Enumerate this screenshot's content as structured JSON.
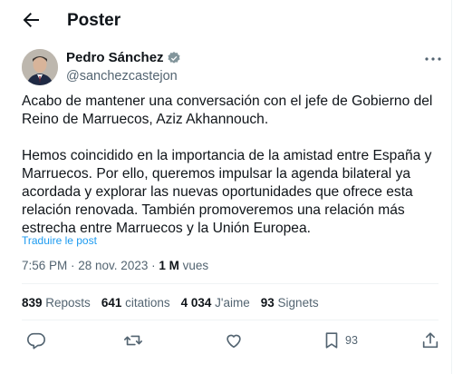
{
  "header": {
    "title": "Poster"
  },
  "author": {
    "name": "Pedro Sánchez",
    "handle": "@sanchezcastejon"
  },
  "tweet": {
    "paragraph1": "Acabo de mantener una conversación con el jefe de Gobierno del Reino de Marruecos, Aziz Akhannouch.",
    "paragraph2": "Hemos coincidido en la importancia de la amistad entre España y Marruecos. Por ello, queremos impulsar la agenda bilateral ya acordada y explorar las nuevas oportunidades que ofrece esta relación renovada. También promoveremos una relación más estrecha entre Marruecos y la Unión Europea.",
    "translate_link": "Traduire le post",
    "timestamp": "7:56 PM · 28 nov. 2023 · ",
    "views_count": "1 M",
    "views_label": " vues"
  },
  "stats": {
    "reposts_count": "839",
    "reposts_label": " Reposts",
    "quotes_count": "641",
    "quotes_label": " citations",
    "likes_count": "4 034",
    "likes_label": " J'aime",
    "bookmarks_count": "93",
    "bookmarks_label": " Signets"
  },
  "actions": {
    "bookmark_count": "93"
  },
  "icons": [
    "back-arrow-icon",
    "verified-badge-icon",
    "more-icon",
    "reply-icon",
    "repost-icon",
    "like-icon",
    "bookmark-icon",
    "share-icon"
  ],
  "colors": {
    "accent": "#1d9bf0",
    "muted": "#536471",
    "text": "#0f1419",
    "divider": "#eff3f4"
  }
}
